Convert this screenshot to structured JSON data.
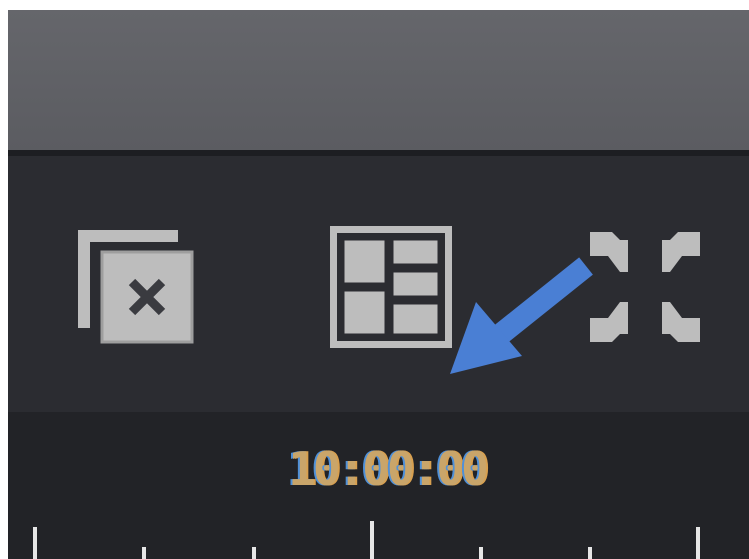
{
  "toolbar": {
    "buttons": [
      {
        "icon": "close-window-icon"
      },
      {
        "icon": "multi-view-layout-icon"
      },
      {
        "icon": "fullscreen-icon"
      }
    ]
  },
  "timeline": {
    "timecode": "10:00:00"
  },
  "annotation": {
    "arrow_color": "#4a7fd4"
  },
  "colors": {
    "panel_bg": "#2b2c31",
    "top_panel": "#5f6065",
    "icon": "#bdbdbd",
    "timecode": "#c9a56a"
  }
}
